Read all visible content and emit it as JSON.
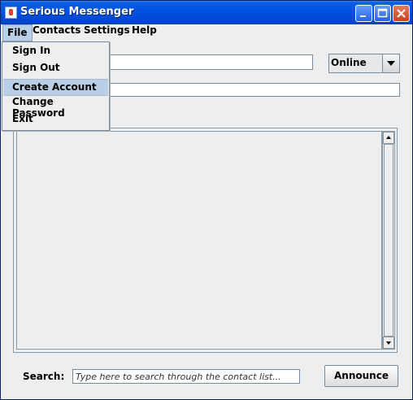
{
  "window": {
    "title": "Serious Messenger"
  },
  "menubar": {
    "items": [
      "File",
      "Contacts",
      "Settings",
      "Help"
    ]
  },
  "file_menu": {
    "items": [
      "Sign In",
      "Sign Out",
      "Create Account",
      "Change Password",
      "Exit"
    ]
  },
  "status": {
    "selected": "Online"
  },
  "search": {
    "label": "Search:",
    "placeholder": "Type here to search through the contact list..."
  },
  "buttons": {
    "announce": "Announce"
  }
}
